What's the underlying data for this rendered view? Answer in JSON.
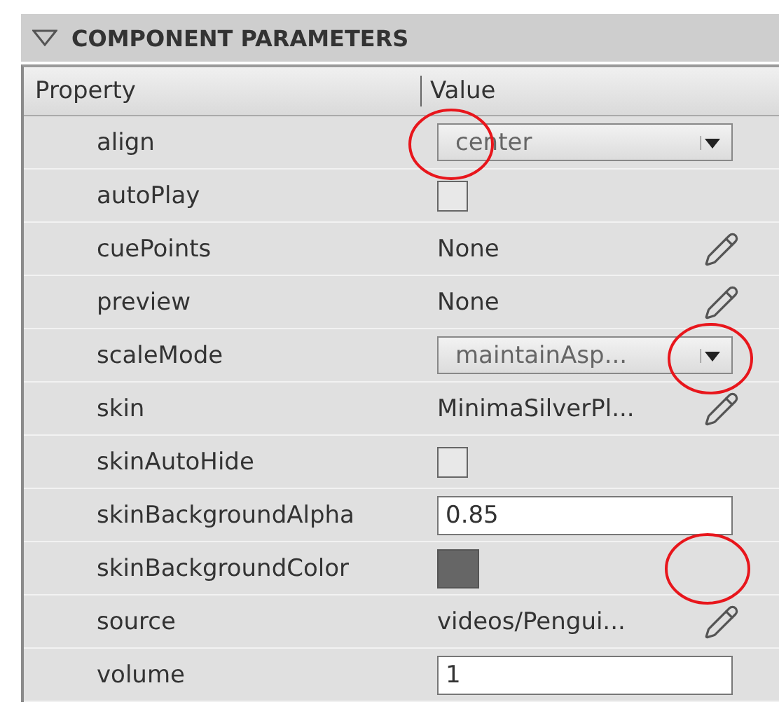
{
  "panel": {
    "title": "COMPONENT PARAMETERS",
    "expanded": true
  },
  "table": {
    "columns": [
      "Property",
      "Value"
    ],
    "rows": [
      {
        "property": "align",
        "kind": "dropdown",
        "value": "center"
      },
      {
        "property": "autoPlay",
        "kind": "checkbox",
        "checked": false
      },
      {
        "property": "cuePoints",
        "kind": "edit",
        "value": "None"
      },
      {
        "property": "preview",
        "kind": "edit",
        "value": "None"
      },
      {
        "property": "scaleMode",
        "kind": "dropdown",
        "value": "maintainAsp..."
      },
      {
        "property": "skin",
        "kind": "edit",
        "value": "MinimaSilverPl..."
      },
      {
        "property": "skinAutoHide",
        "kind": "checkbox",
        "checked": false
      },
      {
        "property": "skinBackgroundAlpha",
        "kind": "input",
        "value": "0.85"
      },
      {
        "property": "skinBackgroundColor",
        "kind": "color",
        "color": "#666666"
      },
      {
        "property": "source",
        "kind": "edit",
        "value": "videos/Pengui..."
      },
      {
        "property": "volume",
        "kind": "input",
        "value": "1"
      }
    ]
  }
}
